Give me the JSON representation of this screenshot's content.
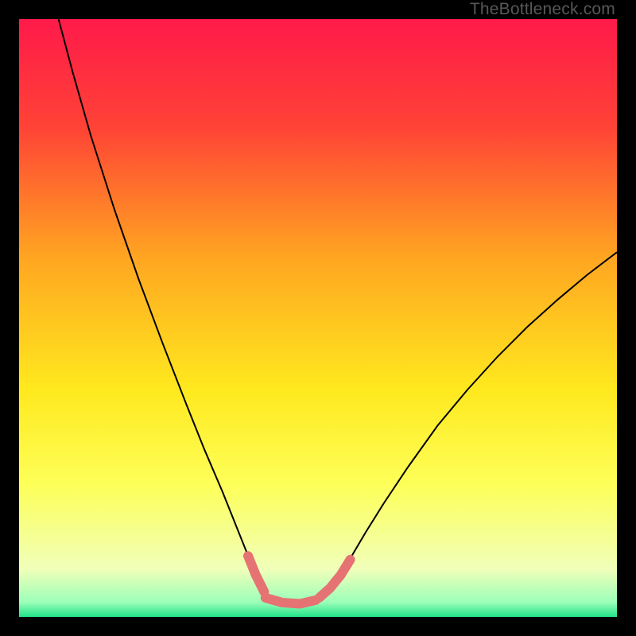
{
  "watermark": "TheBottleneck.com",
  "chart_data": {
    "type": "line",
    "title": "",
    "xlabel": "",
    "ylabel": "",
    "xlim": [
      0,
      100
    ],
    "ylim": [
      0,
      100
    ],
    "gradient_stops": [
      {
        "offset": 0.0,
        "color": "#ff1a4a"
      },
      {
        "offset": 0.18,
        "color": "#ff4236"
      },
      {
        "offset": 0.4,
        "color": "#ffa621"
      },
      {
        "offset": 0.62,
        "color": "#ffe91e"
      },
      {
        "offset": 0.78,
        "color": "#fdff59"
      },
      {
        "offset": 0.92,
        "color": "#f0ffb9"
      },
      {
        "offset": 0.975,
        "color": "#9dffb9"
      },
      {
        "offset": 1.0,
        "color": "#22e38a"
      }
    ],
    "series": [
      {
        "name": "curve",
        "stroke": "#000000",
        "stroke_width": 2,
        "points": [
          {
            "x": 6.6,
            "y": 100.0
          },
          {
            "x": 9.0,
            "y": 91.0
          },
          {
            "x": 12.0,
            "y": 80.5
          },
          {
            "x": 16.0,
            "y": 68.0
          },
          {
            "x": 20.0,
            "y": 56.5
          },
          {
            "x": 24.0,
            "y": 45.8
          },
          {
            "x": 28.0,
            "y": 35.5
          },
          {
            "x": 31.0,
            "y": 28.0
          },
          {
            "x": 34.0,
            "y": 21.0
          },
          {
            "x": 36.6,
            "y": 14.5
          },
          {
            "x": 38.0,
            "y": 11.0
          },
          {
            "x": 39.2,
            "y": 8.0
          },
          {
            "x": 40.0,
            "y": 6.0
          },
          {
            "x": 41.0,
            "y": 4.2
          },
          {
            "x": 42.5,
            "y": 2.8
          },
          {
            "x": 44.0,
            "y": 2.2
          },
          {
            "x": 46.0,
            "y": 2.0
          },
          {
            "x": 48.0,
            "y": 2.1
          },
          {
            "x": 49.5,
            "y": 2.6
          },
          {
            "x": 51.0,
            "y": 3.6
          },
          {
            "x": 52.5,
            "y": 5.2
          },
          {
            "x": 54.0,
            "y": 7.4
          },
          {
            "x": 56.0,
            "y": 10.8
          },
          {
            "x": 58.0,
            "y": 14.2
          },
          {
            "x": 61.0,
            "y": 19.0
          },
          {
            "x": 65.0,
            "y": 25.0
          },
          {
            "x": 70.0,
            "y": 32.0
          },
          {
            "x": 75.0,
            "y": 38.0
          },
          {
            "x": 80.0,
            "y": 43.5
          },
          {
            "x": 85.0,
            "y": 48.5
          },
          {
            "x": 90.0,
            "y": 53.0
          },
          {
            "x": 95.0,
            "y": 57.2
          },
          {
            "x": 100.0,
            "y": 61.0
          }
        ]
      },
      {
        "name": "highlight-left",
        "stroke": "#e57373",
        "stroke_width": 12,
        "linecap": "round",
        "points": [
          {
            "x": 38.3,
            "y": 10.2
          },
          {
            "x": 39.6,
            "y": 7.0
          },
          {
            "x": 41.0,
            "y": 4.2
          }
        ]
      },
      {
        "name": "highlight-bottom",
        "stroke": "#e57373",
        "stroke_width": 12,
        "linecap": "round",
        "points": [
          {
            "x": 41.2,
            "y": 3.2
          },
          {
            "x": 44.0,
            "y": 2.4
          },
          {
            "x": 47.0,
            "y": 2.2
          },
          {
            "x": 49.6,
            "y": 2.8
          }
        ]
      },
      {
        "name": "highlight-right",
        "stroke": "#e57373",
        "stroke_width": 12,
        "linecap": "round",
        "points": [
          {
            "x": 50.2,
            "y": 3.2
          },
          {
            "x": 52.0,
            "y": 4.8
          },
          {
            "x": 53.8,
            "y": 7.0
          },
          {
            "x": 55.4,
            "y": 9.6
          }
        ]
      }
    ]
  }
}
